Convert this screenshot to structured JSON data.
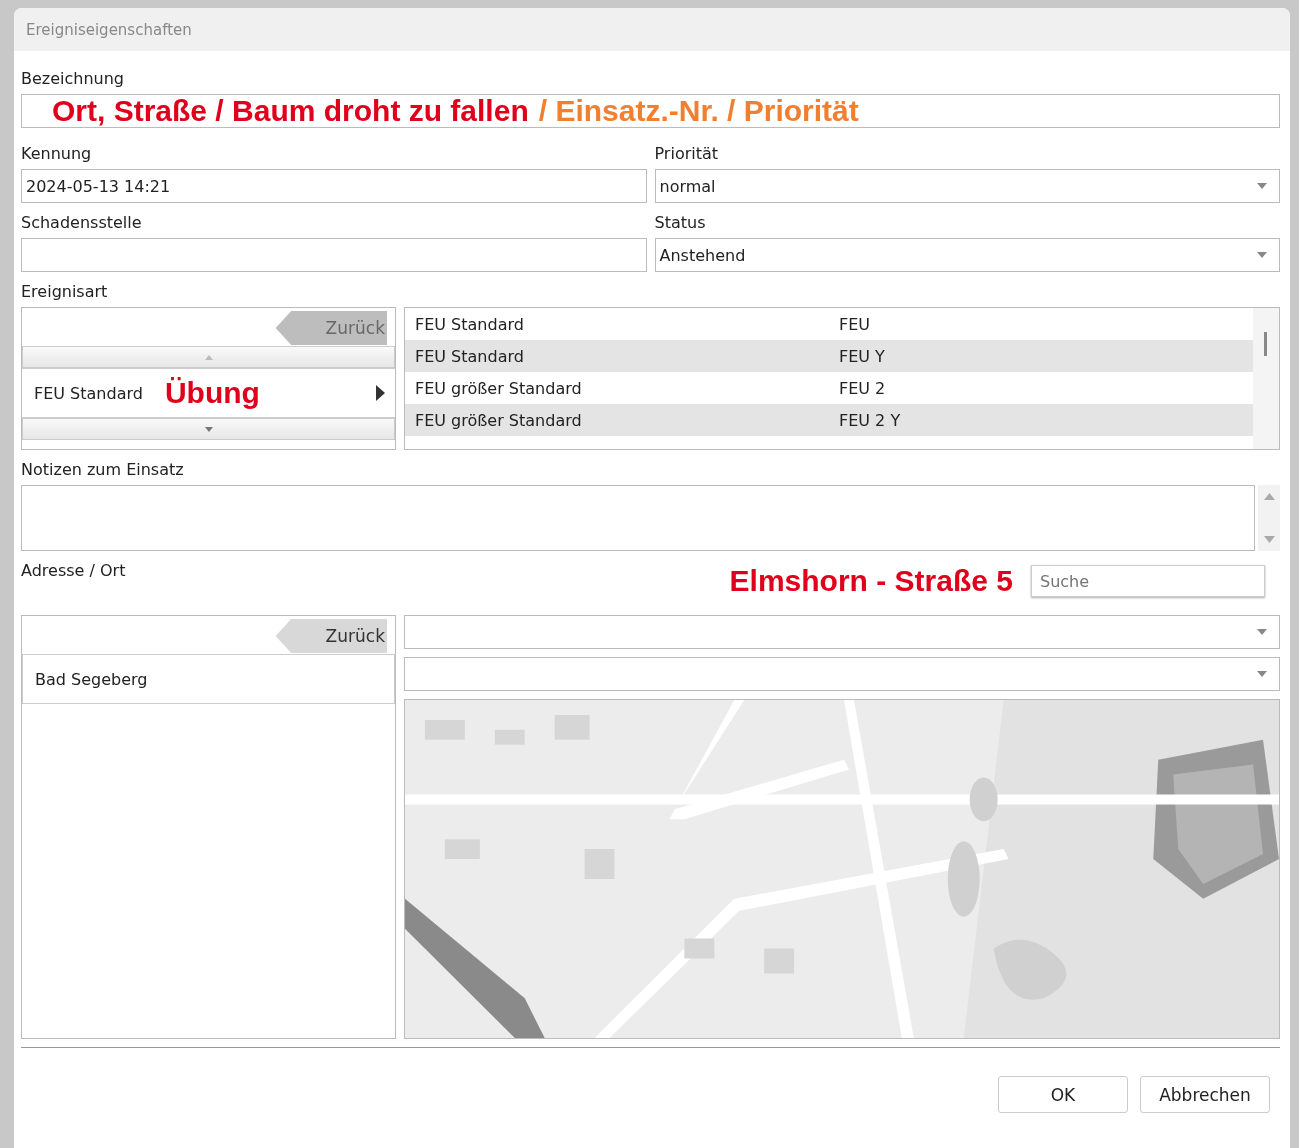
{
  "window": {
    "title": "Ereigniseigenschaften"
  },
  "bezeichnung": {
    "label": "Bezeichnung",
    "annotations": [
      {
        "text": "Ort, Straße / Baum droht zu fallen",
        "color": "#e0001b"
      },
      {
        "text": "/ Einsatz.-Nr. / Priorität",
        "color": "#f08030"
      }
    ]
  },
  "kennung": {
    "label": "Kennung",
    "value": "2024-05-13 14:21"
  },
  "prioritaet": {
    "label": "Priorität",
    "value": "normal"
  },
  "schadensstelle": {
    "label": "Schadensstelle"
  },
  "status": {
    "label": "Status",
    "value": "Anstehend"
  },
  "ereignisart": {
    "label": "Ereignisart",
    "back_button": {
      "label": "Zurück",
      "disabled": true
    },
    "item": {
      "label": "FEU Standard",
      "annotation": "Übung"
    },
    "rows": [
      {
        "name": "FEU Standard",
        "code": "FEU",
        "shaded": false
      },
      {
        "name": "FEU Standard",
        "code": "FEU Y",
        "shaded": true
      },
      {
        "name": "FEU größer Standard",
        "code": "FEU 2",
        "shaded": false
      },
      {
        "name": "FEU größer Standard",
        "code": "FEU 2 Y",
        "shaded": true
      }
    ]
  },
  "notizen": {
    "label": "Notizen zum Einsatz"
  },
  "adresse": {
    "label": "Adresse / Ort",
    "annotation": "Elmshorn - Straße 5",
    "search": {
      "placeholder": "Suche"
    },
    "back_button": {
      "label": "Zurück",
      "disabled": false
    },
    "item": {
      "label": "Bad Segeberg"
    }
  },
  "buttons": [
    {
      "label": "OK"
    },
    {
      "label": "Abbrechen"
    }
  ]
}
